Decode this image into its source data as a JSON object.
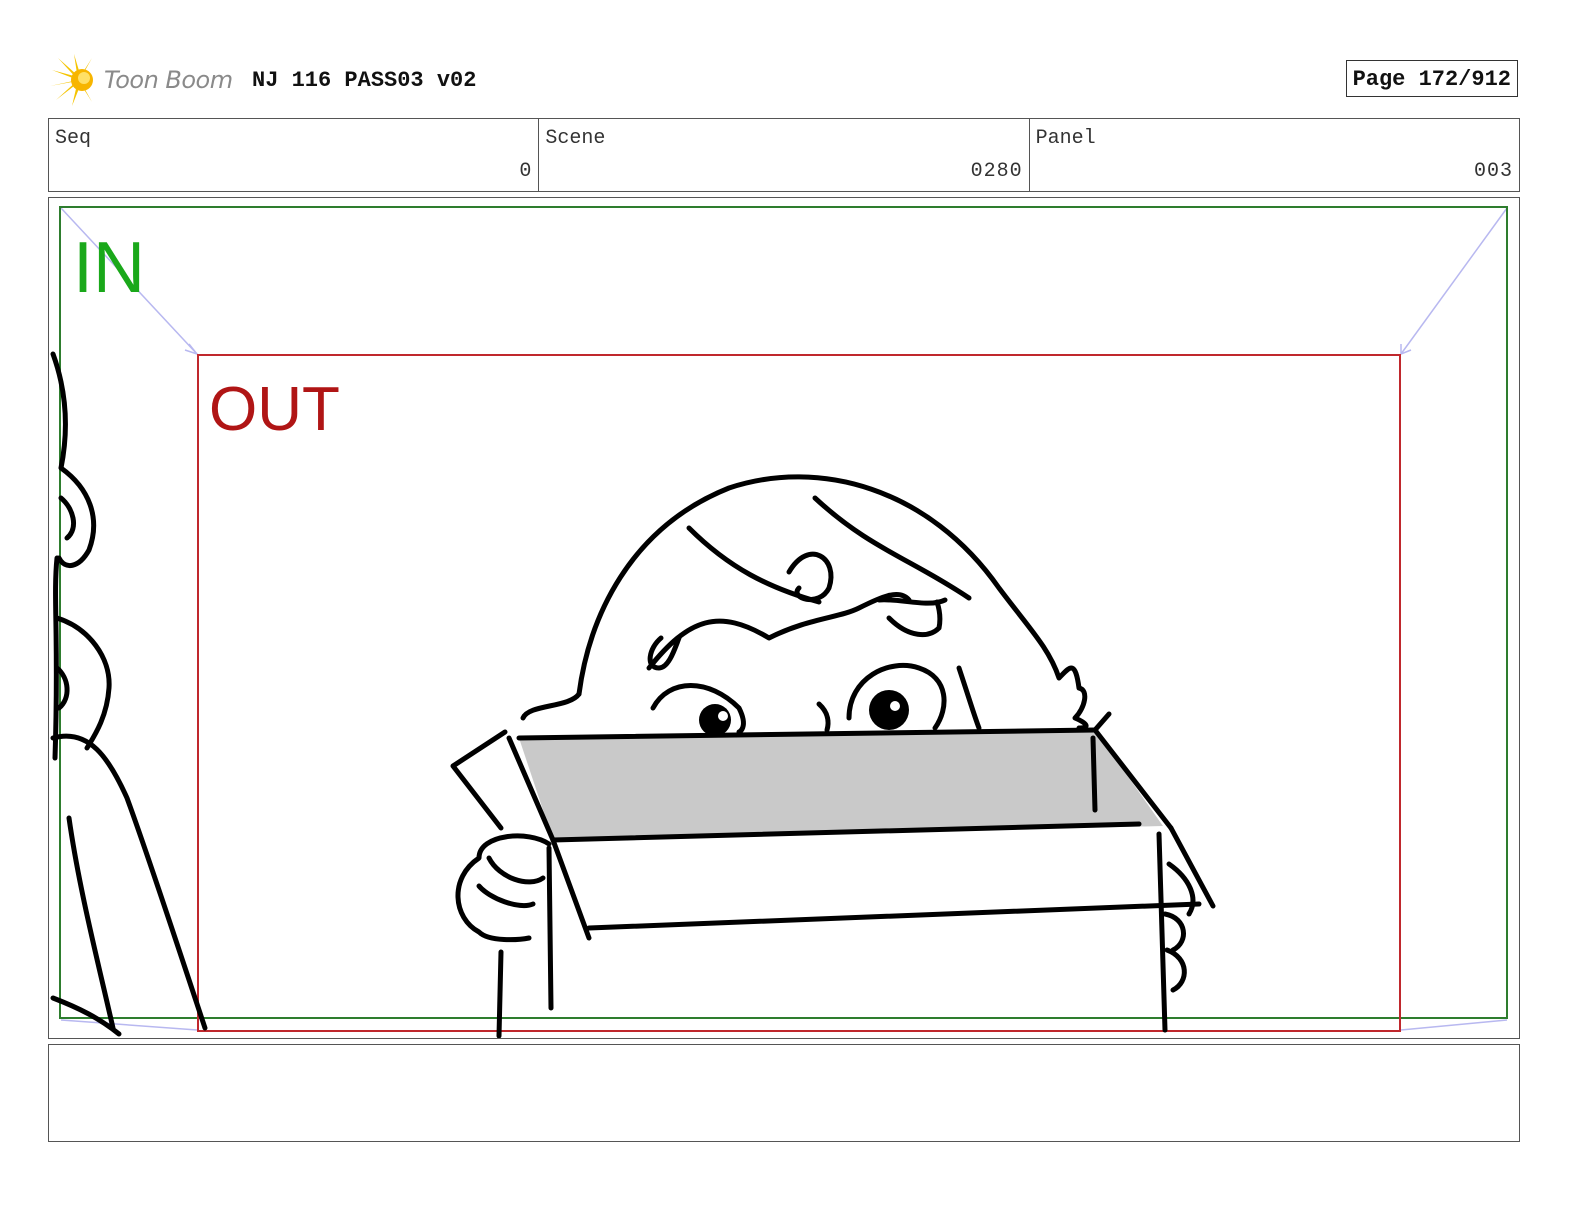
{
  "header": {
    "logo_text": "Toon Boom",
    "project_title": "NJ 116 PASS03 v02",
    "page_label": "Page 172/912"
  },
  "info": {
    "seq_label": "Seq",
    "seq_value": "0",
    "scene_label": "Scene",
    "scene_value": "0280",
    "panel_label": "Panel",
    "panel_value": "003"
  },
  "frame": {
    "in_label": "IN",
    "out_label": "OUT",
    "in_color": "#1aa81a",
    "out_color": "#b01515"
  },
  "caption": {
    "text": ""
  }
}
